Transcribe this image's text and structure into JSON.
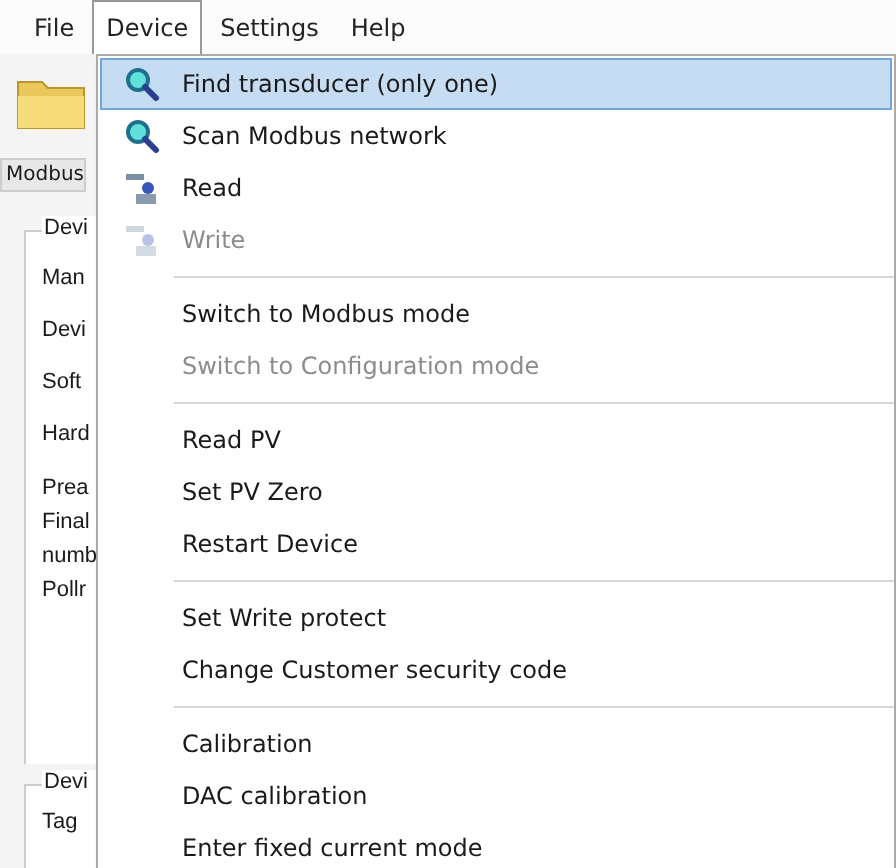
{
  "menu_bar": [
    {
      "label": "File",
      "selected": false
    },
    {
      "label": "Device",
      "selected": true
    },
    {
      "label": "Settings",
      "selected": false
    },
    {
      "label": "Help",
      "selected": false
    }
  ],
  "background": {
    "tab": "Modbus",
    "group_1": {
      "title": "Devi",
      "labels": [
        "Man",
        "Devi",
        "Soft",
        "Hard",
        "Prea",
        "Final",
        "numb",
        "Pollr"
      ]
    },
    "group_2": {
      "title": "Devi",
      "labels": [
        "Tag"
      ]
    }
  },
  "device_menu": [
    [
      {
        "label": "Find transducer (only one)",
        "kind": "search",
        "selected": true,
        "disabled": false
      },
      {
        "label": "Scan Modbus network",
        "kind": "search",
        "selected": false,
        "disabled": false
      },
      {
        "label": "Read",
        "kind": "transfer",
        "selected": false,
        "disabled": false
      },
      {
        "label": "Write",
        "kind": "transfer",
        "selected": false,
        "disabled": true
      }
    ],
    [
      {
        "label": "Switch to Modbus mode",
        "kind": "plain",
        "selected": false,
        "disabled": false
      },
      {
        "label": "Switch to Configuration mode",
        "kind": "plain",
        "selected": false,
        "disabled": true
      }
    ],
    [
      {
        "label": "Read PV",
        "kind": "plain",
        "selected": false,
        "disabled": false
      },
      {
        "label": "Set PV Zero",
        "kind": "plain",
        "selected": false,
        "disabled": false
      },
      {
        "label": "Restart Device",
        "kind": "plain",
        "selected": false,
        "disabled": false
      }
    ],
    [
      {
        "label": "Set Write protect",
        "kind": "plain",
        "selected": false,
        "disabled": false
      },
      {
        "label": "Change Customer security code",
        "kind": "plain",
        "selected": false,
        "disabled": false
      }
    ],
    [
      {
        "label": "Calibration",
        "kind": "plain",
        "selected": false,
        "disabled": false
      },
      {
        "label": "DAC calibration",
        "kind": "plain",
        "selected": false,
        "disabled": false
      },
      {
        "label": "Enter fixed current mode",
        "kind": "plain",
        "selected": false,
        "disabled": false
      }
    ]
  ]
}
